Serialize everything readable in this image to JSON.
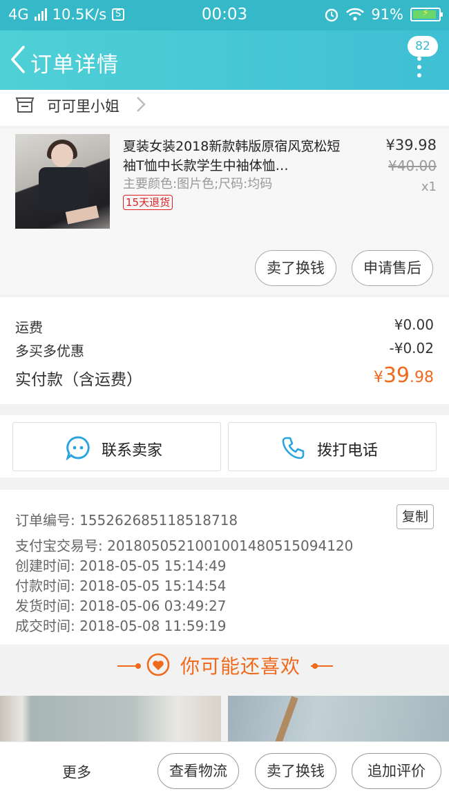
{
  "status_bar": {
    "network": "4G",
    "speed": "10.5K/s",
    "s_icon": "S",
    "time": "00:03",
    "battery": "91%",
    "battery_level": 0.91
  },
  "header": {
    "title": "订单详情",
    "badge": "82"
  },
  "shop": {
    "name": "可可里小姐"
  },
  "goods": {
    "title": "夏装女装2018新款韩版原宿风宽松短袖T恤中长款学生中袖体恤…",
    "sku": "主要颜色:图片色;尺码:均码",
    "refund_tag": "15天退货",
    "price": "¥39.98",
    "original_price": "¥40.00",
    "quantity": "x1",
    "actions": [
      "卖了换钱",
      "申请售后"
    ]
  },
  "fees": {
    "shipping_label": "运费",
    "shipping_value": "¥0.00",
    "discount_label": "多买多优惠",
    "discount_value": "-¥0.02",
    "paid_label": "实付款（含运费）",
    "paid_currency": "¥",
    "paid_integer": "39",
    "paid_decimal": ".98"
  },
  "contact": {
    "seller": "联系卖家",
    "call": "拨打电话"
  },
  "order_info": {
    "order_no": "订单编号: 1552626851185187​18",
    "alipay_no": "支付宝交易号: 2018050521001001480515094120",
    "created": "创建时间: 2018-05-05 15:14:49",
    "paid": "付款时间: 2018-05-05 15:14:54",
    "shipped": "发货时间: 2018-05-06 03:49:27",
    "completed": "成交时间: 2018-05-08 11:59:19",
    "copy": "复制"
  },
  "recommend": {
    "title": "你可能还喜欢"
  },
  "bottom_bar": {
    "more": "更多",
    "logistics": "查看物流",
    "sell": "卖了换钱",
    "review": "追加评价"
  },
  "colors": {
    "accent": "#35b9c9",
    "price_orange": "#f06a1d",
    "refund_red": "#e02020"
  },
  "icons": [
    "back-icon",
    "more-dots-icon",
    "shop-icon",
    "chevron-right-icon",
    "chat-icon",
    "phone-icon",
    "heart-icon",
    "wifi-icon",
    "alarm-icon",
    "battery-icon"
  ]
}
